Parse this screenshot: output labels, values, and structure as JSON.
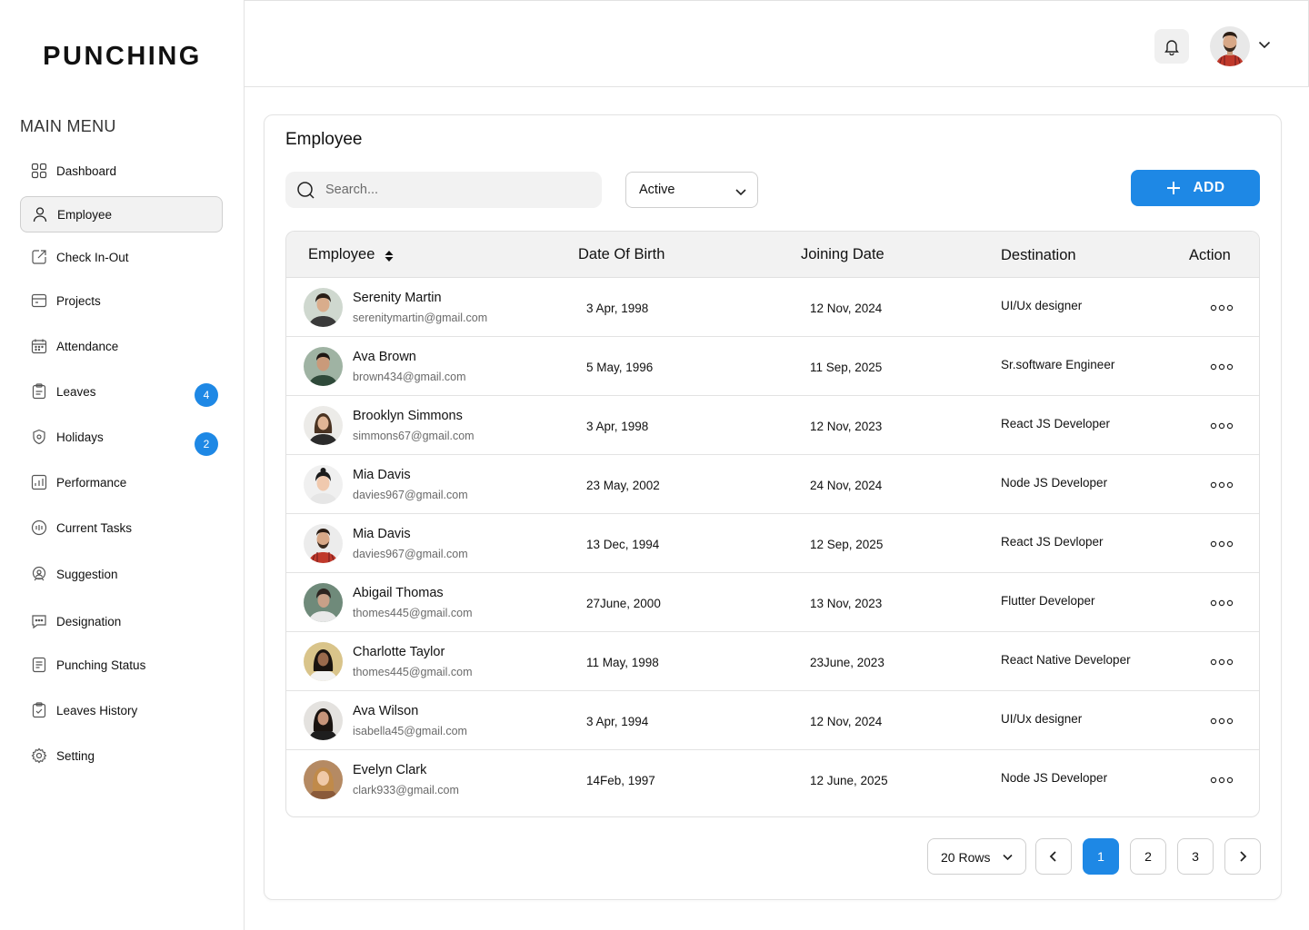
{
  "app": {
    "logo": "PUNCHING"
  },
  "sidebar": {
    "menu_title": "MAIN MENU",
    "items": [
      {
        "label": "Dashboard",
        "icon": "grid-icon"
      },
      {
        "label": "Employee",
        "icon": "user-icon",
        "active": true
      },
      {
        "label": "Check In-Out",
        "icon": "check-in-icon"
      },
      {
        "label": "Projects",
        "icon": "projects-icon"
      },
      {
        "label": "Attendance",
        "icon": "calendar-icon"
      },
      {
        "label": "Leaves",
        "icon": "clipboard-icon",
        "badge": "4"
      },
      {
        "label": "Holidays",
        "icon": "holiday-icon",
        "badge": "2"
      },
      {
        "label": "Performance",
        "icon": "chart-icon"
      },
      {
        "label": "Current Tasks",
        "icon": "tasks-icon"
      },
      {
        "label": "Suggestion",
        "icon": "suggestion-icon"
      },
      {
        "label": "Designation",
        "icon": "designation-icon"
      },
      {
        "label": "Punching Status",
        "icon": "document-icon"
      },
      {
        "label": "Leaves History",
        "icon": "history-icon"
      },
      {
        "label": "Setting",
        "icon": "gear-icon"
      }
    ]
  },
  "header": {
    "bell_icon": "bell-icon",
    "profile_icon": "chevron-down-icon"
  },
  "main": {
    "title": "Employee",
    "search_placeholder": "Search...",
    "status_filter": "Active",
    "add_label": "ADD",
    "columns": [
      "Employee",
      "Date Of Birth",
      "Joining Date",
      "Destination",
      "Action"
    ],
    "rows": [
      {
        "name": "Serenity Martin",
        "email": "serenitymartin@gmail.com",
        "dob": "3 Apr, 1998",
        "joining": "12 Nov, 2024",
        "destination": "UI/Ux designer"
      },
      {
        "name": "Ava Brown",
        "email": "brown434@gmail.com",
        "dob": "5 May, 1996",
        "joining": "11 Sep, 2025",
        "destination": "Sr.software Engineer"
      },
      {
        "name": "Brooklyn Simmons",
        "email": "simmons67@gmail.com",
        "dob": "3 Apr, 1998",
        "joining": "12 Nov, 2023",
        "destination": "React JS Developer"
      },
      {
        "name": "Mia Davis",
        "email": "davies967@gmail.com",
        "dob": "23 May, 2002",
        "joining": "24 Nov, 2024",
        "destination": "Node JS Developer"
      },
      {
        "name": "Mia Davis",
        "email": "davies967@gmail.com",
        "dob": "13 Dec, 1994",
        "joining": "12 Sep, 2025",
        "destination": "React JS Devloper"
      },
      {
        "name": "Abigail Thomas",
        "email": "thomes445@gmail.com",
        "dob": "27June, 2000",
        "joining": "13 Nov, 2023",
        "destination": "Flutter Developer"
      },
      {
        "name": "Charlotte Taylor",
        "email": "thomes445@gmail.com",
        "dob": "11 May, 1998",
        "joining": "23June, 2023",
        "destination": "React Native Developer"
      },
      {
        "name": "Ava Wilson",
        "email": "isabella45@gmail.com",
        "dob": "3 Apr, 1994",
        "joining": "12 Nov, 2024",
        "destination": "UI/Ux designer"
      },
      {
        "name": "Evelyn Clark",
        "email": "clark933@gmail.com",
        "dob": "14Feb, 1997",
        "joining": "12 June, 2025",
        "destination": "Node JS Developer"
      }
    ]
  },
  "pagination": {
    "rows_label": "20 Rows",
    "pages": [
      "1",
      "2",
      "3"
    ],
    "current": "1"
  },
  "colors": {
    "accent": "#1e88e5",
    "border": "#e0e0e0",
    "header_bg": "#f2f2f2"
  }
}
